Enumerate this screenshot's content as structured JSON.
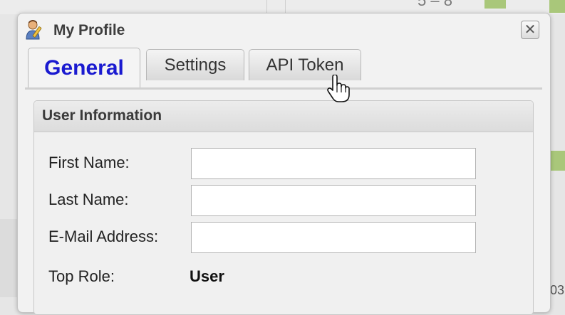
{
  "background": {
    "fragment_top": "5 – 8",
    "fragment_bottom_right": "03"
  },
  "dialog": {
    "title": "My Profile",
    "title_icon": "user-edit-icon",
    "close_symbol": "✕"
  },
  "tabs": [
    {
      "label": "General",
      "active": true
    },
    {
      "label": "Settings",
      "active": false
    },
    {
      "label": "API Token",
      "active": false
    }
  ],
  "section": {
    "title": "User Information",
    "fields": [
      {
        "label": "First Name:",
        "value": "",
        "placeholder": ""
      },
      {
        "label": "Last Name:",
        "value": "",
        "placeholder": ""
      },
      {
        "label": "E-Mail Address:",
        "value": "",
        "placeholder": ""
      }
    ],
    "top_role": {
      "label": "Top Role:",
      "value": "User"
    }
  },
  "colors": {
    "active_tab_text": "#1a1ad0",
    "background_green": "#a9c77a"
  },
  "cursor": "hand-pointer-icon"
}
